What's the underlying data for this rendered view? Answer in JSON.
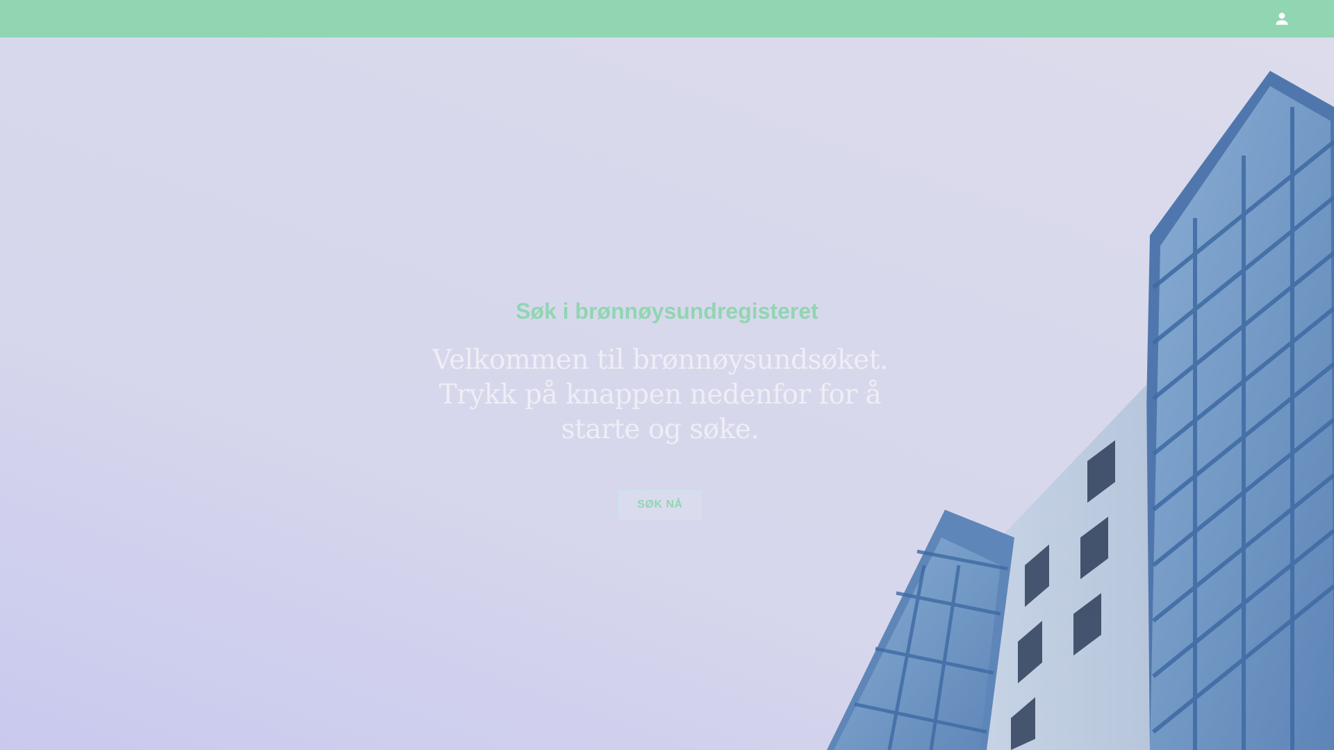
{
  "header": {
    "user_icon": "person-icon",
    "color": "#90d6b2"
  },
  "hero": {
    "title": "Søk i brønnøysundregisteret",
    "subtitle": "Velkommen til brønnøysundsøket. Trykk på knappen nedenfor for å starte og søke.",
    "cta_label": "SØK NÅ",
    "accent_color": "#8fd6b1",
    "background_image": "building-photo"
  }
}
